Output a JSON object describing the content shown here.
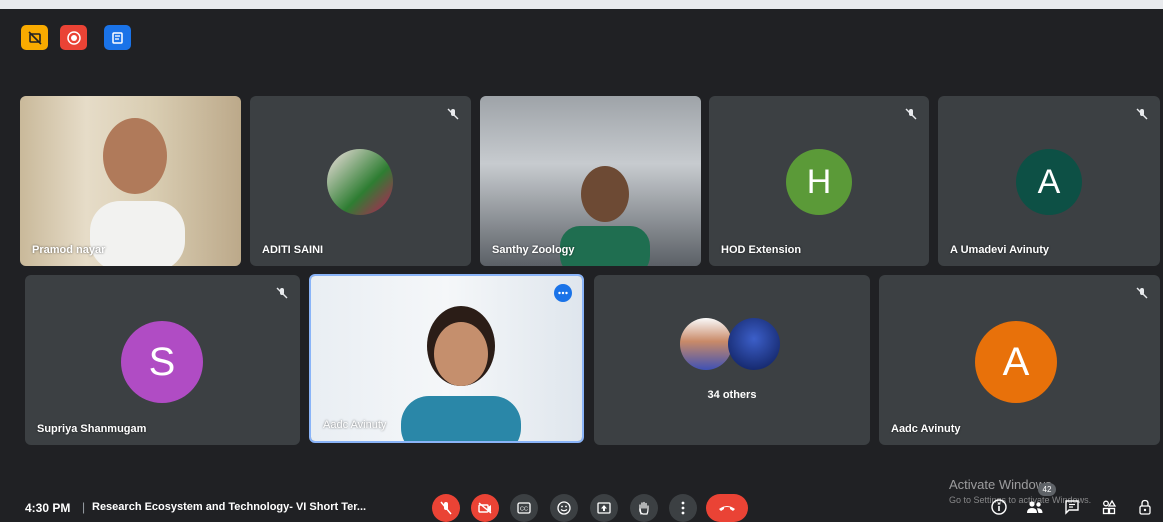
{
  "meeting": {
    "time": "4:30 PM",
    "separator": "|",
    "title": "Research Ecosystem and Technology- VI Short Ter...",
    "participant_count": "42"
  },
  "top_icons": [
    {
      "name": "no-video-icon",
      "color": "#f9ab00"
    },
    {
      "name": "record-icon",
      "color": "#ea4335"
    },
    {
      "name": "notes-icon",
      "color": "#1a73e8"
    }
  ],
  "tiles": {
    "pramod": {
      "name": "Pramod nayar"
    },
    "aditi": {
      "name": "ADITI SAINI"
    },
    "santhy": {
      "name": "Santhy Zoology"
    },
    "hod": {
      "name": "HOD Extension",
      "initial": "H",
      "color": "#5b9a38"
    },
    "umadevi": {
      "name": "A Umadevi Avinuty",
      "initial": "A",
      "color": "#0d5045"
    },
    "supriya": {
      "name": "Supriya Shanmugam",
      "initial": "S",
      "color": "#b04cc4"
    },
    "aadc_video": {
      "name": "Aadc Avinuty"
    },
    "others": {
      "label": "34 others"
    },
    "aadc": {
      "name": "Aadc Avinuty",
      "initial": "A",
      "color": "#e8710a"
    }
  },
  "watermark": {
    "line1": "Activate Windows",
    "line2": "Go to Settings to activate Windows."
  },
  "colors": {
    "background": "#202124",
    "tile": "#3c4043",
    "accent": "#1a73e8",
    "danger": "#ea4335"
  }
}
